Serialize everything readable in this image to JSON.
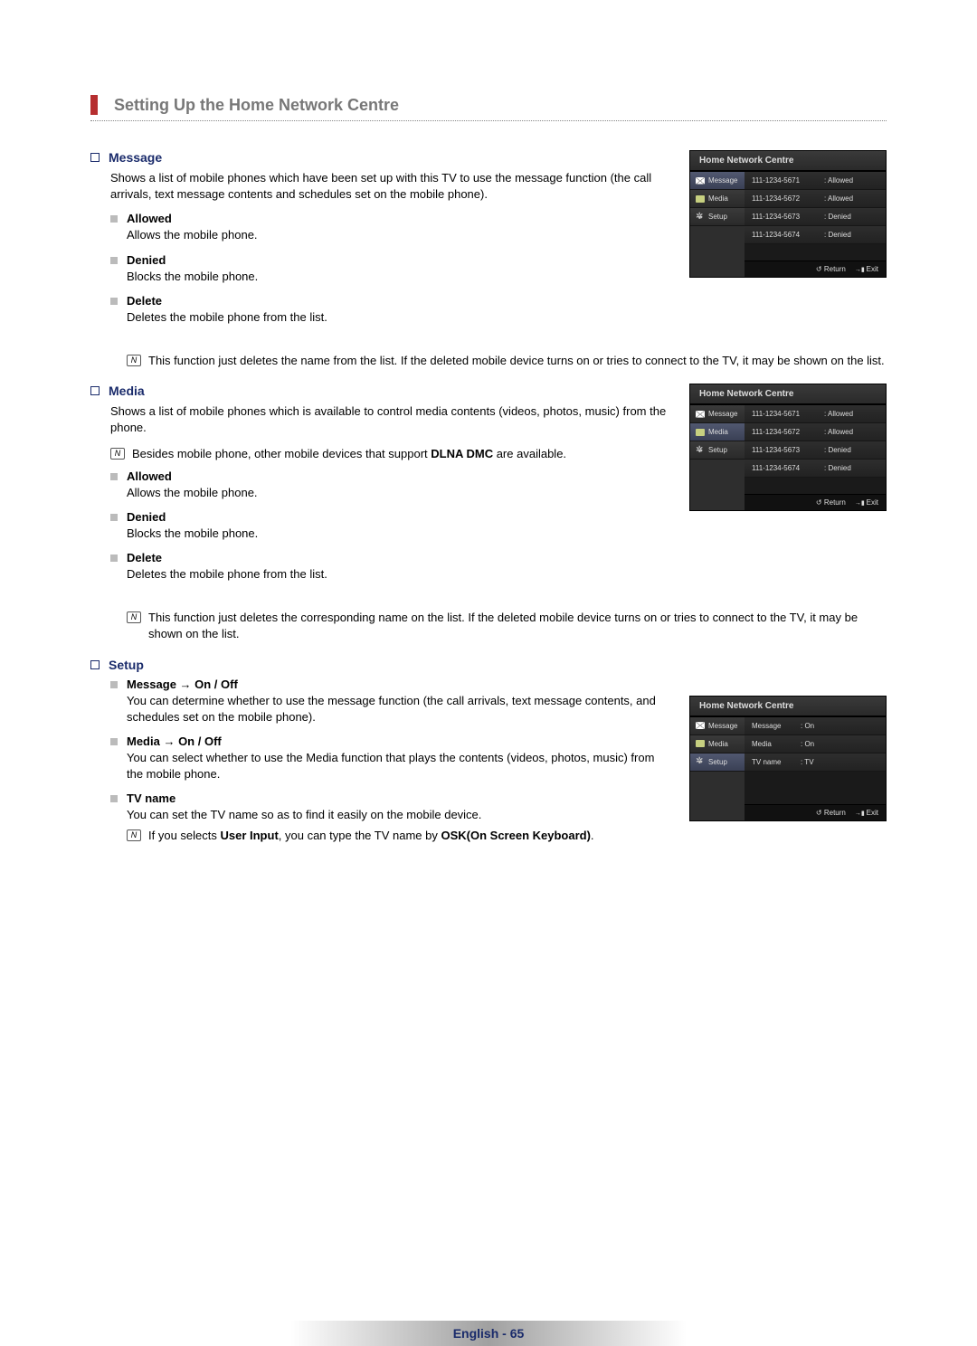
{
  "section_title": "Setting Up the Home Network Centre",
  "message": {
    "title": "Message",
    "desc": "Shows a list of mobile phones which have been set up with this TV to use the message function (the call arrivals, text message contents and schedules set on the mobile phone).",
    "allowed": {
      "title": "Allowed",
      "desc": "Allows the mobile phone."
    },
    "denied": {
      "title": "Denied",
      "desc": "Blocks the mobile phone."
    },
    "delete": {
      "title": "Delete",
      "desc": "Deletes the mobile phone from the list.",
      "note": "This function just deletes the name from the list. If the deleted mobile device turns on or tries to connect to the TV, it may be shown on the list."
    }
  },
  "media": {
    "title": "Media",
    "desc": "Shows a list of mobile phones which is available to control media contents (videos, photos, music) from the phone.",
    "note_top_a": "Besides mobile phone, other mobile devices that support ",
    "note_top_b": "DLNA DMC",
    "note_top_c": " are available.",
    "allowed": {
      "title": "Allowed",
      "desc": "Allows the mobile phone."
    },
    "denied": {
      "title": "Denied",
      "desc": "Blocks the mobile phone."
    },
    "delete": {
      "title": "Delete",
      "desc": "Deletes the mobile phone from the list.",
      "note": "This function just deletes the corresponding name on the list. If the deleted mobile device turns on or tries to connect to the TV, it may be shown on the list."
    }
  },
  "setup": {
    "title": "Setup",
    "msg": {
      "title": "Message → On / Off",
      "desc": "You can determine whether to use the message function (the call arrivals, text message contents, and schedules set on the mobile phone)."
    },
    "media": {
      "title": "Media → On / Off",
      "desc": "You can select whether to use the Media function that plays the contents (videos, photos, music) from the mobile phone."
    },
    "tvname": {
      "title": "TV name",
      "desc": "You can set the TV name so as to find it easily on the mobile device.",
      "note_a": "If you selects ",
      "note_b": "User Input",
      "note_c": ", you can type the TV name by ",
      "note_d": "OSK(On Screen Keyboard)",
      "note_e": "."
    }
  },
  "tv": {
    "title": "Home Network Centre",
    "side": [
      "Message",
      "Media",
      "Setup"
    ],
    "list": [
      {
        "a": "111-1234-5671",
        "b": ": Allowed"
      },
      {
        "a": "111-1234-5672",
        "b": ": Allowed"
      },
      {
        "a": "111-1234-5673",
        "b": ": Denied"
      },
      {
        "a": "111-1234-5674",
        "b": ": Denied"
      }
    ],
    "setup_rows": [
      {
        "a": "Message",
        "b": ": On"
      },
      {
        "a": "Media",
        "b": ": On"
      },
      {
        "a": "TV name",
        "b": ": TV"
      }
    ],
    "return": "Return",
    "exit": "Exit"
  },
  "footer": {
    "lang": "English - ",
    "page": "65"
  }
}
